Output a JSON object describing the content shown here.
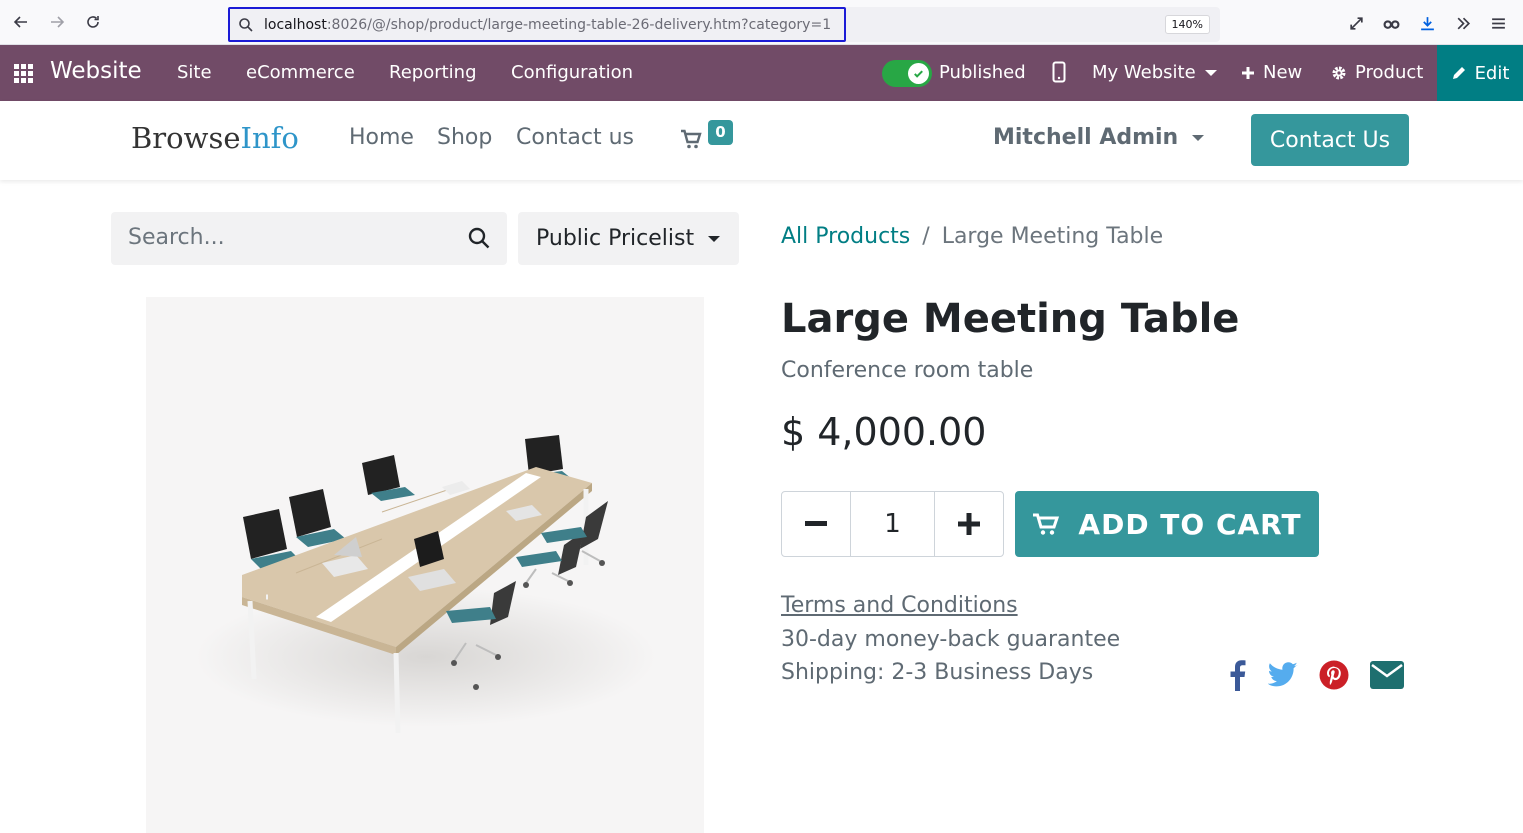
{
  "browser": {
    "url_host": "localhost",
    "url_rest": ":8026/@/shop/product/large-meeting-table-26-delivery.htm?category=1",
    "zoom": "140%"
  },
  "odoo_bar": {
    "app_title": "Website",
    "menu": [
      "Site",
      "eCommerce",
      "Reporting",
      "Configuration"
    ],
    "published_label": "Published",
    "website_label": "My Website",
    "new_label": "New",
    "product_label": "Product",
    "edit_label": "Edit"
  },
  "header": {
    "logo_part1": "Browse",
    "logo_part2": "Info",
    "nav": [
      "Home",
      "Shop",
      "Contact us"
    ],
    "cart_count": "0",
    "user_name": "Mitchell Admin",
    "contact_button": "Contact Us"
  },
  "shop": {
    "search_placeholder": "Search...",
    "pricelist": "Public Pricelist",
    "breadcrumb_link": "All Products",
    "breadcrumb_separator": "/",
    "breadcrumb_current": "Large Meeting Table"
  },
  "product": {
    "name": "Large Meeting Table",
    "description": "Conference room table",
    "price": "$ 4,000.00",
    "quantity": "1",
    "add_to_cart_label": "ADD TO CART",
    "terms_label": "Terms and Conditions",
    "guarantee": "30-day money-back guarantee",
    "shipping": "Shipping: 2-3 Business Days"
  },
  "colors": {
    "odoo_purple": "#714b67",
    "teal": "#35979c",
    "edit_teal": "#017e84",
    "published_green": "#28a745",
    "facebook": "#3b5998",
    "twitter": "#55acee",
    "pinterest": "#cb2027",
    "email": "#1e6f6f"
  },
  "share_icons": [
    "facebook-icon",
    "twitter-icon",
    "pinterest-icon",
    "envelope-icon"
  ]
}
